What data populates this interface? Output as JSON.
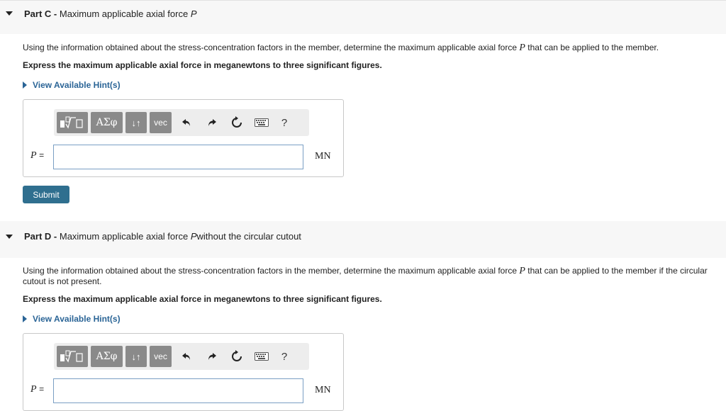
{
  "partC": {
    "title_prefix": "Part C -",
    "title_text": "Maximum applicable axial force",
    "title_var": "P",
    "desc_before": "Using the information obtained about the stress-concentration factors in the member, determine the maximum applicable axial force",
    "desc_var": "P",
    "desc_after": "that can be applied to the member.",
    "instruction": "Express the maximum applicable axial force in meganewtons to three significant figures.",
    "hint": "View Available Hint(s)",
    "var_label": "P",
    "equals": "=",
    "input_value": "",
    "unit": "MN",
    "submit": "Submit"
  },
  "partD": {
    "title_prefix": "Part D -",
    "title_text": "Maximum applicable axial force",
    "title_var": "P",
    "title_suffix": "without the circular cutout",
    "desc_before": "Using the information obtained about the stress-concentration factors in the member, determine the maximum applicable axial force",
    "desc_var": "P",
    "desc_after": "that can be applied to the member if the circular cutout is not present.",
    "instruction": "Express the maximum applicable axial force in meganewtons to three significant figures.",
    "hint": "View Available Hint(s)",
    "var_label": "P",
    "equals": "=",
    "input_value": "",
    "unit": "MN"
  },
  "toolbar": {
    "greek": "ΑΣφ",
    "arrows": "↓↑",
    "vec": "vec",
    "help": "?",
    "icons": [
      "templates-icon",
      "greek-letters-icon",
      "subscript-superscript-icon",
      "vector-icon",
      "undo-icon",
      "redo-icon",
      "reset-icon",
      "keyboard-icon",
      "help-icon"
    ]
  }
}
